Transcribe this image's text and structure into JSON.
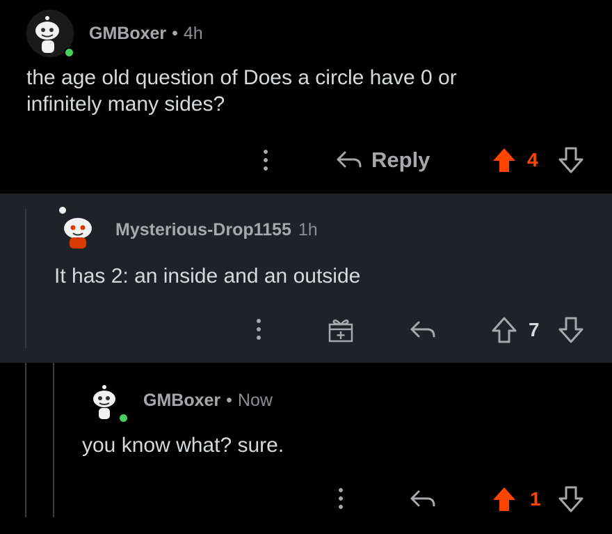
{
  "colors": {
    "background": "#000000",
    "nested_background": "#1f2226",
    "text": "#d7dadc",
    "muted": "#a6a8ab",
    "upvote_active": "#ff4500",
    "online": "#46d160"
  },
  "comments": [
    {
      "username": "GMBoxer",
      "separator": "•",
      "time": "4h",
      "body": "the age old question of Does a circle have 0 or\ninfinitely many sides?",
      "reply_label": "Reply",
      "score": "4",
      "upvoted": true,
      "online": true
    },
    {
      "username": "Mysterious-Drop1155",
      "separator": "",
      "time": "1h",
      "body": "It has 2: an inside and an outside",
      "reply_label": "",
      "score": "7",
      "upvoted": false,
      "online": false
    },
    {
      "username": "GMBoxer",
      "separator": "•",
      "time": "Now",
      "body": "you know what? sure.",
      "reply_label": "",
      "score": "1",
      "upvoted": true,
      "online": true
    }
  ],
  "icons": {
    "more": "kebab-icon",
    "reply": "reply-arrow-icon",
    "upvote": "upvote-arrow-icon",
    "downvote": "downvote-arrow-icon",
    "award": "gift-icon"
  }
}
